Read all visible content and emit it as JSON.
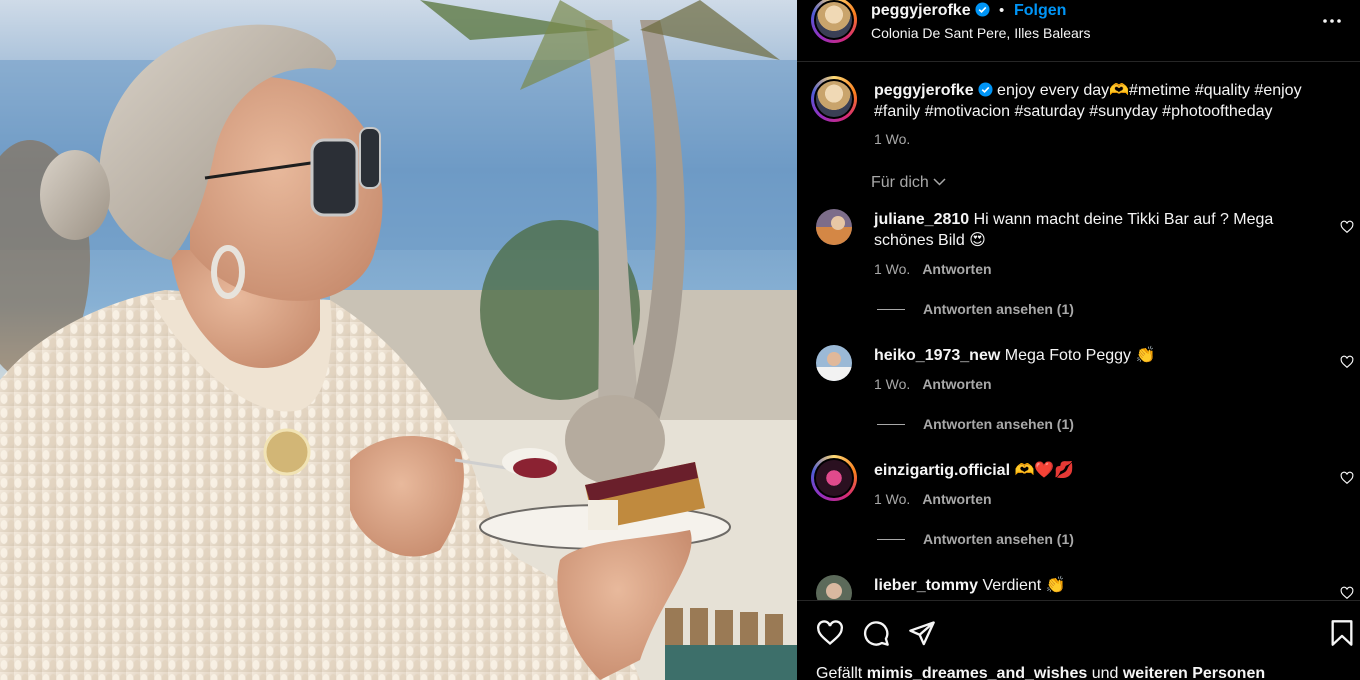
{
  "header": {
    "username": "peggyjerofke",
    "dot": "•",
    "follow_label": "Folgen",
    "location": "Colonia De Sant Pere, Illes Balears"
  },
  "caption": {
    "username": "peggyjerofke",
    "text": "enjoy every day🫶#metime #quality #enjoy #fanily #motivacion #saturday #sunyday #photooftheday",
    "time": "1 Wo."
  },
  "for_you_label": "Für dich",
  "comments": [
    {
      "username": "juliane_2810",
      "text": "Hi wann macht deine Tikki Bar auf ? Mega schönes Bild 😍",
      "time": "1 Wo.",
      "reply_label": "Antworten",
      "view_replies": "Antworten ansehen (1)"
    },
    {
      "username": "heiko_1973_new",
      "text": "Mega Foto Peggy 👏",
      "time": "1 Wo.",
      "reply_label": "Antworten",
      "view_replies": "Antworten ansehen (1)"
    },
    {
      "username": "einzigartig.official",
      "text": "🫶❤️💋",
      "time": "1 Wo.",
      "reply_label": "Antworten",
      "view_replies": "Antworten ansehen (1)"
    },
    {
      "username": "lieber_tommy",
      "text": "Verdient 👏"
    }
  ],
  "likes": {
    "prefix": "Gefällt ",
    "user": "mimis_dreames_and_wishes",
    "middle": " und ",
    "rest": "weiteren Personen"
  },
  "colors": {
    "accent": "#0095f6",
    "secondary_text": "#a8a8a8",
    "divider": "#262626",
    "verified": "#0095f6"
  },
  "icons": [
    "verified-icon",
    "more-options-icon",
    "chevron-down-icon",
    "heart-icon",
    "comment-icon",
    "share-icon",
    "bookmark-icon"
  ]
}
